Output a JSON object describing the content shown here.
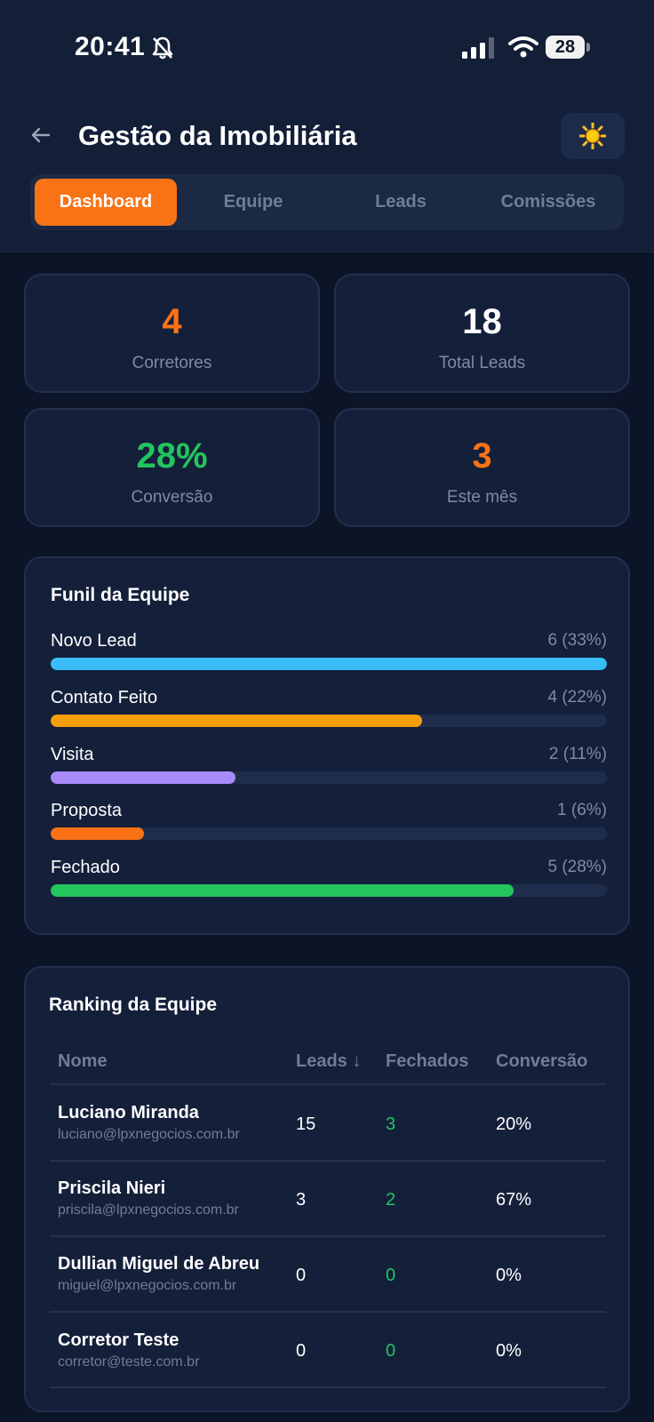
{
  "status_bar": {
    "time": "20:41",
    "battery": "28"
  },
  "header": {
    "title": "Gestão da Imobiliária"
  },
  "tabs": [
    {
      "label": "Dashboard",
      "active": true
    },
    {
      "label": "Equipe",
      "active": false
    },
    {
      "label": "Leads",
      "active": false
    },
    {
      "label": "Comissões",
      "active": false
    }
  ],
  "stats": [
    {
      "value": "4",
      "label": "Corretores",
      "color": "#f97316"
    },
    {
      "value": "18",
      "label": "Total Leads",
      "color": "#ffffff"
    },
    {
      "value": "28%",
      "label": "Conversão",
      "color": "#22c55e"
    },
    {
      "value": "3",
      "label": "Este mês",
      "color": "#f97316"
    }
  ],
  "funnel": {
    "title": "Funil da Equipe",
    "stages": [
      {
        "label": "Novo Lead",
        "count": "6 (33%)",
        "fill": 1.0,
        "color": "#38bdf8"
      },
      {
        "label": "Contato Feito",
        "count": "4 (22%)",
        "fill": 0.667,
        "color": "#f59e0b"
      },
      {
        "label": "Visita",
        "count": "2 (11%)",
        "fill": 0.333,
        "color": "#a78bfa"
      },
      {
        "label": "Proposta",
        "count": "1 (6%)",
        "fill": 0.167,
        "color": "#f97316"
      },
      {
        "label": "Fechado",
        "count": "5 (28%)",
        "fill": 0.833,
        "color": "#22c55e"
      }
    ]
  },
  "ranking": {
    "title": "Ranking da Equipe",
    "columns": {
      "name": "Nome",
      "leads": "Leads ↓",
      "closed": "Fechados",
      "conversion": "Conversão"
    },
    "rows": [
      {
        "name": "Luciano Miranda",
        "email": "luciano@lpxnegocios.com.br",
        "leads": "15",
        "closed": "3",
        "conversion": "20%"
      },
      {
        "name": "Priscila Nieri",
        "email": "priscila@lpxnegocios.com.br",
        "leads": "3",
        "closed": "2",
        "conversion": "67%"
      },
      {
        "name": "Dullian Miguel de Abreu",
        "email": "miguel@lpxnegocios.com.br",
        "leads": "0",
        "closed": "0",
        "conversion": "0%"
      },
      {
        "name": "Corretor Teste",
        "email": "corretor@teste.com.br",
        "leads": "0",
        "closed": "0",
        "conversion": "0%"
      }
    ]
  }
}
